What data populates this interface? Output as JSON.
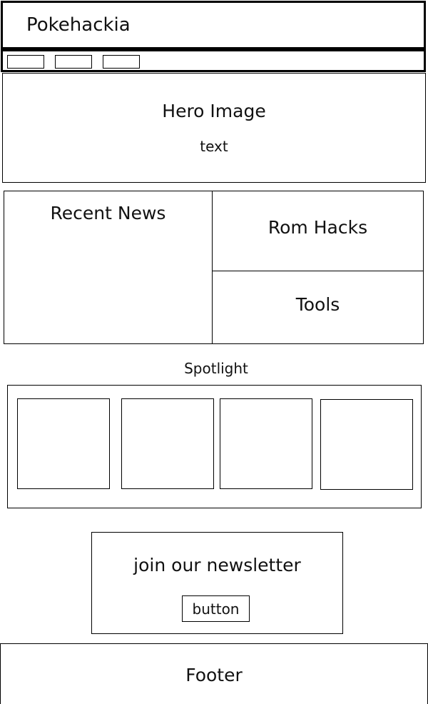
{
  "header": {
    "site_title": "Pokehackia"
  },
  "nav": {
    "items": [
      "",
      "",
      ""
    ]
  },
  "hero": {
    "title": "Hero Image",
    "subtitle": "text"
  },
  "recent_news": {
    "title": "Recent News"
  },
  "rom_hacks": {
    "title": "Rom Hacks"
  },
  "tools": {
    "title": "Tools"
  },
  "spotlight": {
    "label": "Spotlight",
    "cards": [
      "",
      "",
      "",
      ""
    ]
  },
  "newsletter": {
    "title": "join our newsletter",
    "button_label": "button"
  },
  "footer": {
    "title": "Footer"
  }
}
